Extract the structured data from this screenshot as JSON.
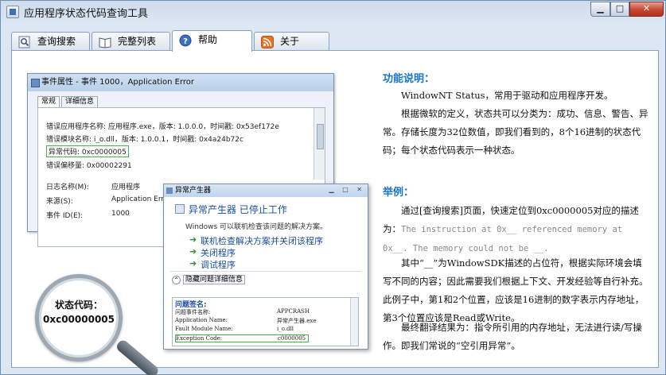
{
  "window": {
    "title": "应用程序状态代码查询工具",
    "min_label": "▁",
    "max_label": "□",
    "close_label": "✕"
  },
  "tabs": [
    {
      "label": "查询搜索",
      "icon": "search-icon"
    },
    {
      "label": "完整列表",
      "icon": "book-icon"
    },
    {
      "label": "帮助",
      "icon": "help-icon"
    },
    {
      "label": "关于",
      "icon": "rss-icon"
    }
  ],
  "active_tab": "帮助",
  "illustration": {
    "event_window": {
      "title": "事件属性 - 事件 1000，Application Error",
      "tab_general": "常规",
      "tab_details": "详细信息",
      "line1": "错误应用程序名称: 应用程序.exe，版本: 1.0.0.0，时间戳: 0x53ef172e",
      "line2": "错误模块名称: i_o.dll，版本: 1.0.0.1，时间戳: 0x4a24b72c",
      "line3": "异常代码: 0xc0000005",
      "line4": "错误偏移量: 0x00002291",
      "log_name_label": "日志名称(M):",
      "log_name_value": "应用程序",
      "source_label": "来源(S):",
      "source_value": "Application Error",
      "event_id_label": "事件 ID(E):",
      "event_id_value": "1000"
    },
    "crash_dialog": {
      "title": "异常产生器",
      "heading": "异常产生器 已停止工作",
      "subtext": "Windows 可以联机检查该问题的解决方案。",
      "option1": "联机检查解决方案并关闭该程序",
      "option2": "关闭程序",
      "option3": "调试程序",
      "detail_toggle": "隐藏问题详细信息",
      "detail_header": "问题签名:",
      "rows": [
        {
          "k": "问题事件名称:",
          "v": "APPCRASH"
        },
        {
          "k": "Application Name:",
          "v": "异常产生器.exe"
        },
        {
          "k": "Fault Module Name:",
          "v": "i_o.dll"
        },
        {
          "k": "Exception Code:",
          "v": "c0000005"
        }
      ]
    },
    "magnifier": {
      "line1": "状态代码：",
      "line2": "0xc00000005"
    }
  },
  "help": {
    "section1_title": "功能说明：",
    "section1_p1": "WindowNT Status，常用于驱动和应用程序开发。",
    "section1_p2": "根据微软的定义，状态共可以分类为：成功、信息、警告、异常。存储长度为32位数值，即我们看到的，8个16进制的状态代码；每个状态代码表示一种状态。",
    "section2_title": "举例：",
    "section2_p1_a": "通过[查询搜索]页面，快速定位到0xc0000005对应的描述为：",
    "section2_p1_grey": "The instruction at 0x__ referenced memory at 0x__. The memory could not be __.",
    "section2_p2": "其中“__”为WindowSDK描述的占位符，根据实际环境会填写不同的内容；因此需要我们根据上下文、开发经验等自行补充。此例子中，第1和2个位置，应该是16进制的数字表示内存地址，第3个位置应该是Read或Write。",
    "section2_p3": "最终翻译结果为：指令所引用的内存地址，无法进行读/写操作。即我们常说的“空引用异常”。"
  }
}
